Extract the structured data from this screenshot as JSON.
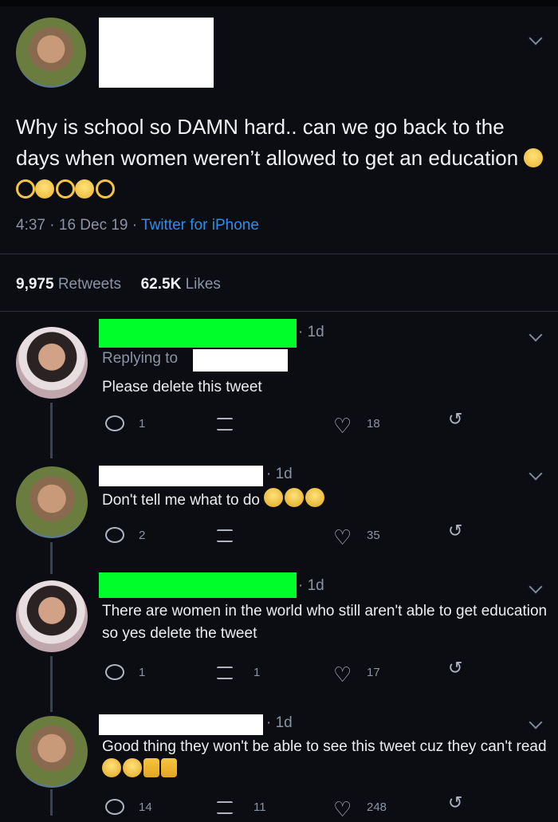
{
  "tweet": {
    "text": "Why is school so DAMN hard.. can we go back to the days when women weren’t allowed to get an education",
    "emoji_row": [
      "weary-face",
      "ok-hand",
      "weary-face",
      "ok-hand",
      "weary-face",
      "ok-hand"
    ],
    "time": "4:37",
    "date": "16 Dec 19",
    "source": "Twitter for iPhone",
    "sep": "·",
    "retweets_count": "9,975",
    "retweets_label": "Retweets",
    "likes_count": "62.5K",
    "likes_label": "Likes"
  },
  "replies": [
    {
      "time": "1d",
      "replying_label": "Replying to",
      "text": "Please delete this tweet",
      "reply_count": "1",
      "retweet_count": "",
      "like_count": "18"
    },
    {
      "time": "1d",
      "text": "Don't tell me what to do",
      "emoji_row": [
        "joy",
        "joy",
        "joy"
      ],
      "reply_count": "2",
      "retweet_count": "",
      "like_count": "35"
    },
    {
      "time": "1d",
      "text": "There are women in the world who still aren't able to get education so yes delete the tweet",
      "reply_count": "1",
      "retweet_count": "1",
      "like_count": "17"
    },
    {
      "time": "1d",
      "text": "Good thing they won't be able to see this tweet cuz they can't read",
      "emoji_row": [
        "joy",
        "joy",
        "thumbs-up",
        "thumbs-up"
      ],
      "reply_count": "14",
      "retweet_count": "11",
      "like_count": "248"
    }
  ],
  "colors": {
    "background": "#0c0d12",
    "link": "#2c8ee8",
    "muted": "#8b93a6",
    "redact_green": "#00ff2a"
  }
}
